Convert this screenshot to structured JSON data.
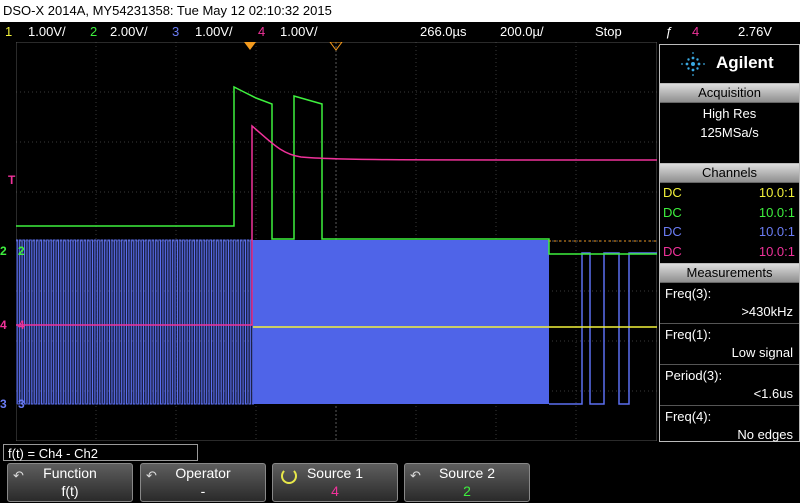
{
  "title": "DSO-X 2014A, MY54231358: Tue May 12 02:10:32 2015",
  "status": {
    "ch1_num": "1",
    "ch1_scale": "1.00V/",
    "ch2_num": "2",
    "ch2_scale": "2.00V/",
    "ch3_num": "3",
    "ch3_scale": "1.00V/",
    "ch4_num": "4",
    "ch4_scale": "1.00V/",
    "delay": "266.0µs",
    "timebase": "200.0µ/",
    "run_state": "Stop",
    "trigger_slope": "ƒ",
    "trigger_source": "4",
    "trigger_level": "2.76V"
  },
  "logo": {
    "brand": "Agilent"
  },
  "acquisition": {
    "header": "Acquisition",
    "mode": "High Res",
    "rate": "125MSa/s"
  },
  "channels": {
    "header": "Channels",
    "rows": [
      {
        "coupling": "DC",
        "probe": "10.0:1",
        "color": "#f2f23a"
      },
      {
        "coupling": "DC",
        "probe": "10.0:1",
        "color": "#3ef03e"
      },
      {
        "coupling": "DC",
        "probe": "10.0:1",
        "color": "#6b7df5"
      },
      {
        "coupling": "DC",
        "probe": "10.0:1",
        "color": "#f0329a"
      }
    ]
  },
  "measurements": {
    "header": "Measurements",
    "items": [
      {
        "label": "Freq(3):",
        "value": ">430kHz"
      },
      {
        "label": "Freq(1):",
        "value": "Low signal"
      },
      {
        "label": "Period(3):",
        "value": "<1.6us"
      },
      {
        "label": "Freq(4):",
        "value": "No edges"
      }
    ]
  },
  "function_bar": {
    "formula": "f(t) = Ch4 - Ch2",
    "softkeys": [
      {
        "top": "Function",
        "bottom": "f(t)",
        "bottom_color": "#ffffff"
      },
      {
        "top": "Operator",
        "bottom": "-",
        "bottom_color": "#ffffff"
      },
      {
        "top": "Source 1",
        "bottom": "4",
        "bottom_color": "#f0329a"
      },
      {
        "top": "Source 2",
        "bottom": "2",
        "bottom_color": "#3ef03e"
      }
    ]
  },
  "markers": {
    "ch2": "2",
    "ch4": "4",
    "ch3": "3",
    "trigger": "T"
  },
  "colors": {
    "ch1": "#f2f23a",
    "ch2": "#3ef03e",
    "ch3": "#5b6ff0",
    "ch4": "#f0329a",
    "trigger": "#f39a1e"
  }
}
